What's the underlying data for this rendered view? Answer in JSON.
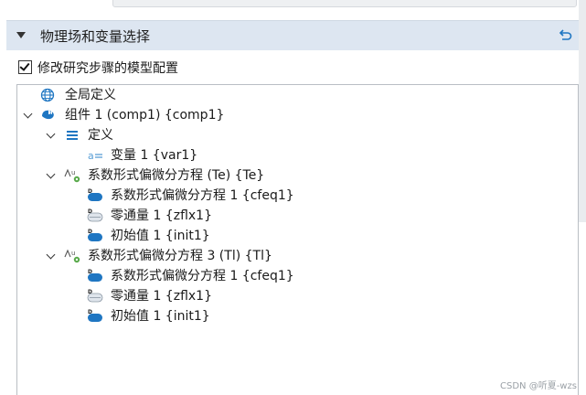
{
  "section": {
    "title": "物理场和变量选择",
    "checkbox_label": "修改研究步骤的模型配置",
    "checkbox_checked": true
  },
  "tree": {
    "global_defs": "全局定义",
    "component": "组件 1 (comp1) {comp1}",
    "definitions": "定义",
    "variable": "变量 1 {var1}",
    "pde_te": "系数形式偏微分方程 (Te) {Te}",
    "pde_te_children": [
      "系数形式偏微分方程 1 {cfeq1}",
      "零通量 1 {zflx1}",
      "初始值 1 {init1}"
    ],
    "pde_tl": "系数形式偏微分方程 3 (Tl) {Tl}",
    "pde_tl_children": [
      "系数形式偏微分方程 1 {cfeq1}",
      "零通量 1 {zflx1}",
      "初始值 1 {init1}"
    ]
  },
  "watermark": "CSDN @听夏-wzs",
  "colors": {
    "header_bg": "#dde6f1",
    "icon_blue": "#1f76c2"
  }
}
